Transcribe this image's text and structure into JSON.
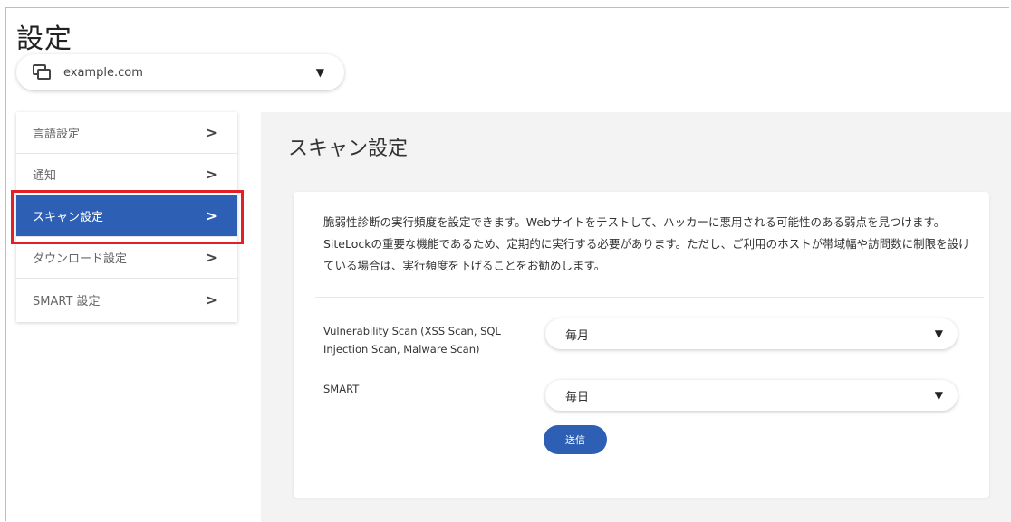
{
  "page": {
    "title": "設定"
  },
  "site_selector": {
    "value": "example.com",
    "icon": "windows-icon"
  },
  "sidebar": {
    "items": [
      {
        "label": "言語設定",
        "active": false
      },
      {
        "label": "通知",
        "active": false
      },
      {
        "label": "スキャン設定",
        "active": true
      },
      {
        "label": "ダウンロード設定",
        "active": false
      },
      {
        "label": "SMART 設定",
        "active": false
      }
    ]
  },
  "main": {
    "title": "スキャン設定",
    "description": "脆弱性診断の実行頻度を設定できます。Webサイトをテストして、ハッカーに悪用される可能性のある弱点を見つけます。SiteLockの重要な機能であるため、定期的に実行する必要があります。ただし、ご利用のホストが帯域幅や訪問数に制限を設けている場合は、実行頻度を下げることをお勧めします。",
    "fields": [
      {
        "label": "Vulnerability Scan (XSS Scan, SQL Injection Scan, Malware Scan)",
        "value": "毎月"
      },
      {
        "label": "SMART",
        "value": "毎日"
      }
    ],
    "submit_label": "送信"
  },
  "colors": {
    "accent": "#2d5fb5",
    "highlight": "#e3202a",
    "panel_bg": "#f3f3f3"
  }
}
